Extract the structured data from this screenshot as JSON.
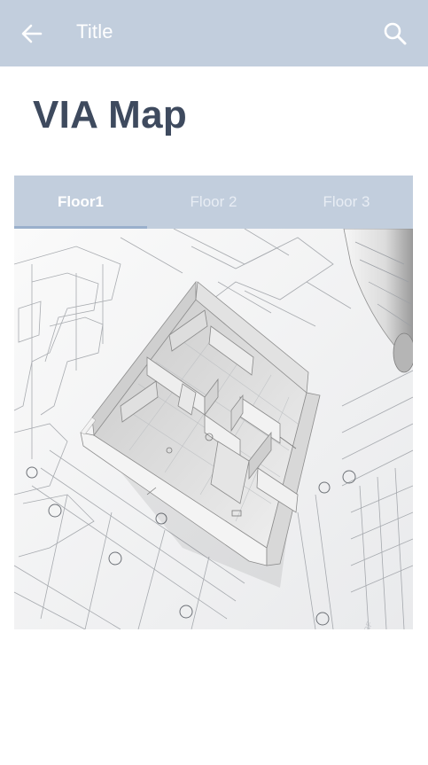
{
  "appbar": {
    "title": "Title",
    "back_icon": "arrow-left-icon",
    "search_icon": "search-icon",
    "background": "#c2cedd"
  },
  "heading": "VIA Map",
  "tabs": [
    {
      "label": "Floor1",
      "active": true
    },
    {
      "label": "Floor 2",
      "active": false
    },
    {
      "label": "Floor 3",
      "active": false
    }
  ],
  "map": {
    "image": "3d-floor-plan-over-architectural-blueprints"
  },
  "colors": {
    "accent": "#c2cedd",
    "heading": "#3e4a5e",
    "tab_indicator": "#9ab0cc"
  }
}
